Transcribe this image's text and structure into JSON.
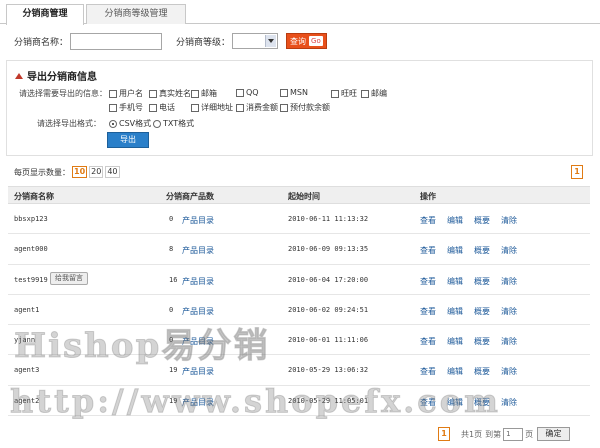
{
  "tabs": [
    "分销商管理",
    "分销商等级管理"
  ],
  "search": {
    "name_label": "分销商名称：",
    "name_value": "",
    "level_label": "分销商等级：",
    "level_value": "",
    "query_label": "查询",
    "go_label": "Go"
  },
  "export": {
    "title": "导出分销商信息",
    "fields_label": "请选择需要导出的信息：",
    "fields": [
      "用户名",
      "真实姓名",
      "邮箱",
      "QQ",
      "MSN",
      "旺旺",
      "邮编",
      "手机号",
      "电话",
      "详细地址",
      "消费金额",
      "预付款余额"
    ],
    "format_label": "请选择导出格式：",
    "formats": [
      "CSV格式",
      "TXT格式"
    ],
    "selected_format": "CSV格式",
    "button_label": "导出"
  },
  "paging": {
    "per_page_label": "每页显示数量：",
    "per_page_options": [
      "10",
      "20",
      "40"
    ],
    "per_page_selected": "10",
    "current_page": "1"
  },
  "table": {
    "columns": [
      "分销商名称",
      "分销商产品数",
      "起始时间",
      "操作"
    ],
    "rows": [
      {
        "name": "bbsxp123",
        "count": "0",
        "product_link": "产品目录",
        "time": "2010-06-11 11:13:32"
      },
      {
        "name": "agent000",
        "count": "8",
        "product_link": "产品目录",
        "time": "2010-06-09 09:13:35"
      },
      {
        "name": "test9919",
        "count": "16",
        "product_link": "产品目录",
        "time": "2010-06-04 17:20:00",
        "message": "给我留言"
      },
      {
        "name": "agent1",
        "count": "0",
        "product_link": "产品目录",
        "time": "2010-06-02 09:24:51"
      },
      {
        "name": "yjann",
        "count": "0",
        "product_link": "产品目录",
        "time": "2010-06-01 11:11:06"
      },
      {
        "name": "agent3",
        "count": "19",
        "product_link": "产品目录",
        "time": "2010-05-29 13:06:32"
      },
      {
        "name": "agent2",
        "count": "19",
        "product_link": "产品目录",
        "time": "2010-05-29 11:05:01"
      }
    ],
    "actions": [
      "查看",
      "编辑",
      "概要",
      "清除"
    ]
  },
  "footer": {
    "total_pages_text": "共1页",
    "goto_prefix": "到第",
    "goto_value": "1",
    "goto_suffix": "页",
    "confirm_label": "确定"
  },
  "watermark": {
    "line1": "Hishop易分销",
    "line2": "http://www.shopefx.com"
  }
}
